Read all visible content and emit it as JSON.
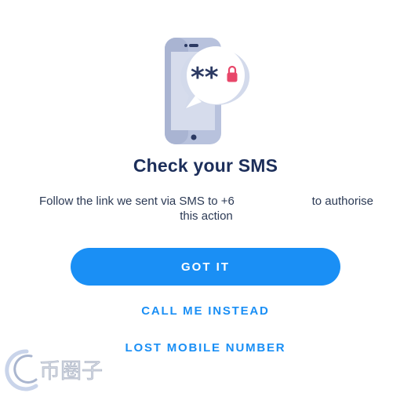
{
  "screen": {
    "title": "Check your SMS",
    "message_part1": "Follow the link we sent via SMS to +6",
    "message_part2": "to authorise",
    "message_part3": "this action"
  },
  "actions": {
    "primary_label": "GOT IT",
    "call_label": "CALL ME INSTEAD",
    "lost_label": "LOST MOBILE NUMBER"
  },
  "illustration": {
    "bubble_text": "**",
    "icons": [
      "phone-icon",
      "chat-bubble-icon",
      "lock-icon"
    ]
  },
  "watermark": {
    "text": "币圈子"
  },
  "colors": {
    "primary": "#1a8ff5",
    "title": "#1c2e5a",
    "lock": "#e8476a",
    "phone_body": "#b8c2dd"
  }
}
